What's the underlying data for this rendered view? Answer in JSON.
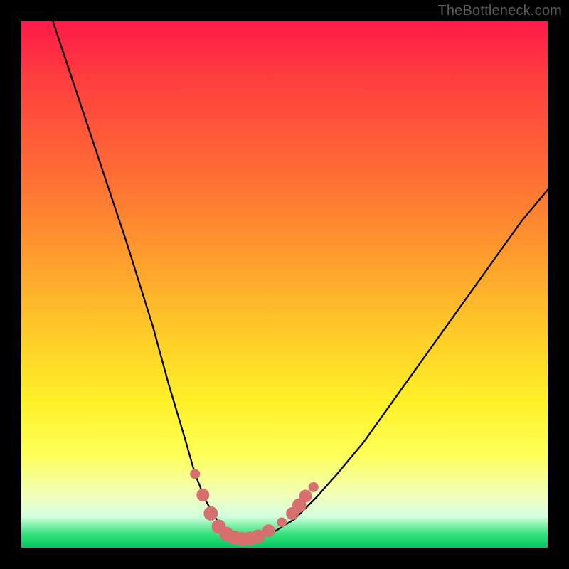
{
  "watermark": {
    "text": "TheBottleneck.com"
  },
  "chart_data": {
    "type": "line",
    "title": "",
    "xlabel": "",
    "ylabel": "",
    "xlim": [
      0,
      100
    ],
    "ylim": [
      0,
      100
    ],
    "series": [
      {
        "name": "bottleneck-curve",
        "x": [
          6,
          10,
          15,
          20,
          25,
          28,
          31,
          33,
          35,
          37,
          39,
          41,
          43,
          45,
          48,
          52,
          56,
          60,
          65,
          70,
          75,
          80,
          85,
          90,
          95,
          100
        ],
        "y": [
          100,
          88,
          73,
          58,
          42,
          31,
          21,
          14,
          9,
          5.5,
          3,
          2,
          1.5,
          2,
          3,
          5.5,
          9.5,
          14,
          20,
          27,
          34,
          41,
          48,
          55,
          62,
          68
        ],
        "color": "#000000",
        "width": 2.3
      }
    ],
    "markers": {
      "name": "bottom-dots",
      "points": [
        {
          "x": 33.0,
          "y": 14.0,
          "r": 7
        },
        {
          "x": 34.5,
          "y": 10.0,
          "r": 9
        },
        {
          "x": 36.0,
          "y": 6.5,
          "r": 10
        },
        {
          "x": 37.5,
          "y": 4.0,
          "r": 10
        },
        {
          "x": 39.0,
          "y": 2.6,
          "r": 10
        },
        {
          "x": 40.5,
          "y": 1.9,
          "r": 10
        },
        {
          "x": 42.0,
          "y": 1.6,
          "r": 10
        },
        {
          "x": 43.5,
          "y": 1.7,
          "r": 10
        },
        {
          "x": 45.0,
          "y": 2.1,
          "r": 10
        },
        {
          "x": 47.0,
          "y": 3.2,
          "r": 9
        },
        {
          "x": 49.5,
          "y": 4.8,
          "r": 7
        },
        {
          "x": 51.5,
          "y": 6.5,
          "r": 9
        },
        {
          "x": 52.8,
          "y": 8.0,
          "r": 10
        },
        {
          "x": 54.0,
          "y": 9.8,
          "r": 9
        },
        {
          "x": 55.5,
          "y": 11.5,
          "r": 7
        }
      ],
      "color": "#d86f6f"
    }
  }
}
